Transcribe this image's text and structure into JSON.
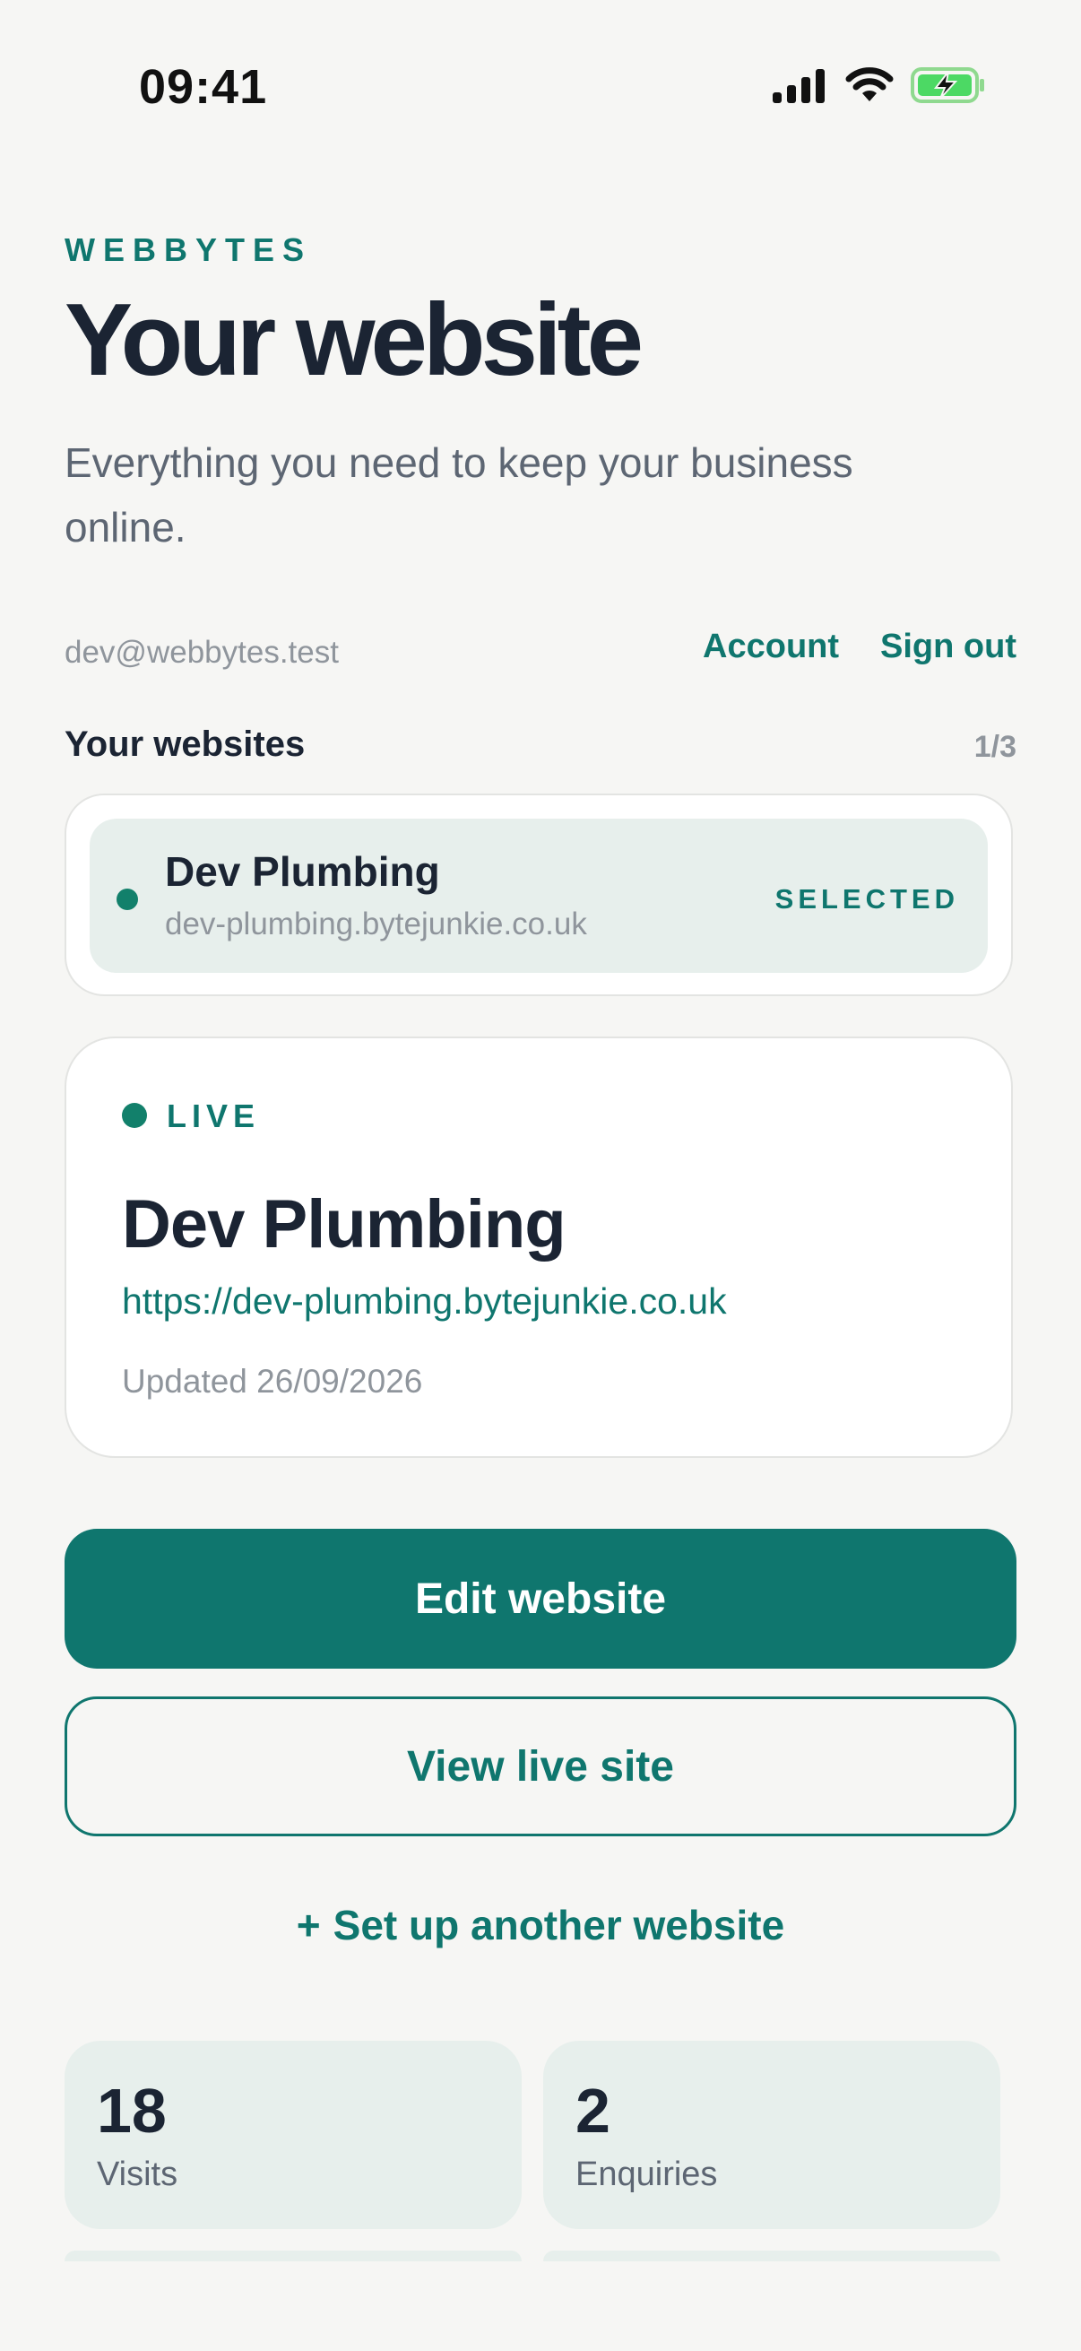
{
  "status_bar": {
    "time": "09:41"
  },
  "header": {
    "brand": "WEBBYTES",
    "title": "Your website",
    "subtitle": "Everything you need to keep your business online."
  },
  "account": {
    "email": "dev@webbytes.test",
    "account_label": "Account",
    "sign_out_label": "Sign out"
  },
  "websites": {
    "title": "Your websites",
    "count": "1/3",
    "items": [
      {
        "name": "Dev Plumbing",
        "domain": "dev-plumbing.bytejunkie.co.uk",
        "badge": "SELECTED"
      }
    ]
  },
  "live_site": {
    "status": "LIVE",
    "name": "Dev Plumbing",
    "url": "https://dev-plumbing.bytejunkie.co.uk",
    "updated": "Updated 26/09/2026"
  },
  "actions": {
    "edit_label": "Edit website",
    "view_label": "View live site",
    "add_label": "Set up another website",
    "add_icon": "+"
  },
  "stats": [
    {
      "value": "18",
      "label": "Visits"
    },
    {
      "value": "2",
      "label": "Enquiries"
    }
  ],
  "colors": {
    "accent": "#0f766e",
    "live": "#12806b",
    "background": "#f6f6f4",
    "tile": "#e7efec",
    "text": "#1b2433",
    "muted": "#8f959c"
  }
}
